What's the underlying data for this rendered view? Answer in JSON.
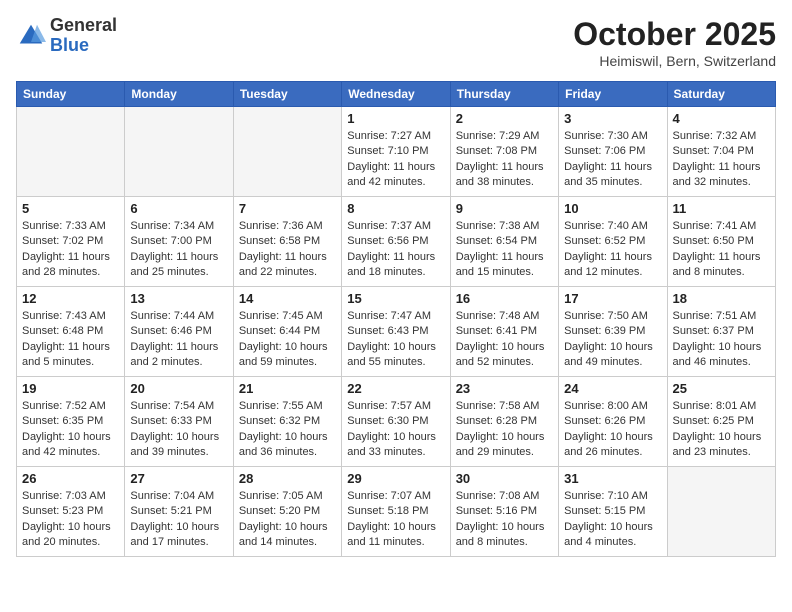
{
  "header": {
    "logo_general": "General",
    "logo_blue": "Blue",
    "month": "October 2025",
    "location": "Heimiswil, Bern, Switzerland"
  },
  "days_of_week": [
    "Sunday",
    "Monday",
    "Tuesday",
    "Wednesday",
    "Thursday",
    "Friday",
    "Saturday"
  ],
  "weeks": [
    [
      {
        "day": "",
        "info": ""
      },
      {
        "day": "",
        "info": ""
      },
      {
        "day": "",
        "info": ""
      },
      {
        "day": "1",
        "info": "Sunrise: 7:27 AM\nSunset: 7:10 PM\nDaylight: 11 hours\nand 42 minutes."
      },
      {
        "day": "2",
        "info": "Sunrise: 7:29 AM\nSunset: 7:08 PM\nDaylight: 11 hours\nand 38 minutes."
      },
      {
        "day": "3",
        "info": "Sunrise: 7:30 AM\nSunset: 7:06 PM\nDaylight: 11 hours\nand 35 minutes."
      },
      {
        "day": "4",
        "info": "Sunrise: 7:32 AM\nSunset: 7:04 PM\nDaylight: 11 hours\nand 32 minutes."
      }
    ],
    [
      {
        "day": "5",
        "info": "Sunrise: 7:33 AM\nSunset: 7:02 PM\nDaylight: 11 hours\nand 28 minutes."
      },
      {
        "day": "6",
        "info": "Sunrise: 7:34 AM\nSunset: 7:00 PM\nDaylight: 11 hours\nand 25 minutes."
      },
      {
        "day": "7",
        "info": "Sunrise: 7:36 AM\nSunset: 6:58 PM\nDaylight: 11 hours\nand 22 minutes."
      },
      {
        "day": "8",
        "info": "Sunrise: 7:37 AM\nSunset: 6:56 PM\nDaylight: 11 hours\nand 18 minutes."
      },
      {
        "day": "9",
        "info": "Sunrise: 7:38 AM\nSunset: 6:54 PM\nDaylight: 11 hours\nand 15 minutes."
      },
      {
        "day": "10",
        "info": "Sunrise: 7:40 AM\nSunset: 6:52 PM\nDaylight: 11 hours\nand 12 minutes."
      },
      {
        "day": "11",
        "info": "Sunrise: 7:41 AM\nSunset: 6:50 PM\nDaylight: 11 hours\nand 8 minutes."
      }
    ],
    [
      {
        "day": "12",
        "info": "Sunrise: 7:43 AM\nSunset: 6:48 PM\nDaylight: 11 hours\nand 5 minutes."
      },
      {
        "day": "13",
        "info": "Sunrise: 7:44 AM\nSunset: 6:46 PM\nDaylight: 11 hours\nand 2 minutes."
      },
      {
        "day": "14",
        "info": "Sunrise: 7:45 AM\nSunset: 6:44 PM\nDaylight: 10 hours\nand 59 minutes."
      },
      {
        "day": "15",
        "info": "Sunrise: 7:47 AM\nSunset: 6:43 PM\nDaylight: 10 hours\nand 55 minutes."
      },
      {
        "day": "16",
        "info": "Sunrise: 7:48 AM\nSunset: 6:41 PM\nDaylight: 10 hours\nand 52 minutes."
      },
      {
        "day": "17",
        "info": "Sunrise: 7:50 AM\nSunset: 6:39 PM\nDaylight: 10 hours\nand 49 minutes."
      },
      {
        "day": "18",
        "info": "Sunrise: 7:51 AM\nSunset: 6:37 PM\nDaylight: 10 hours\nand 46 minutes."
      }
    ],
    [
      {
        "day": "19",
        "info": "Sunrise: 7:52 AM\nSunset: 6:35 PM\nDaylight: 10 hours\nand 42 minutes."
      },
      {
        "day": "20",
        "info": "Sunrise: 7:54 AM\nSunset: 6:33 PM\nDaylight: 10 hours\nand 39 minutes."
      },
      {
        "day": "21",
        "info": "Sunrise: 7:55 AM\nSunset: 6:32 PM\nDaylight: 10 hours\nand 36 minutes."
      },
      {
        "day": "22",
        "info": "Sunrise: 7:57 AM\nSunset: 6:30 PM\nDaylight: 10 hours\nand 33 minutes."
      },
      {
        "day": "23",
        "info": "Sunrise: 7:58 AM\nSunset: 6:28 PM\nDaylight: 10 hours\nand 29 minutes."
      },
      {
        "day": "24",
        "info": "Sunrise: 8:00 AM\nSunset: 6:26 PM\nDaylight: 10 hours\nand 26 minutes."
      },
      {
        "day": "25",
        "info": "Sunrise: 8:01 AM\nSunset: 6:25 PM\nDaylight: 10 hours\nand 23 minutes."
      }
    ],
    [
      {
        "day": "26",
        "info": "Sunrise: 7:03 AM\nSunset: 5:23 PM\nDaylight: 10 hours\nand 20 minutes."
      },
      {
        "day": "27",
        "info": "Sunrise: 7:04 AM\nSunset: 5:21 PM\nDaylight: 10 hours\nand 17 minutes."
      },
      {
        "day": "28",
        "info": "Sunrise: 7:05 AM\nSunset: 5:20 PM\nDaylight: 10 hours\nand 14 minutes."
      },
      {
        "day": "29",
        "info": "Sunrise: 7:07 AM\nSunset: 5:18 PM\nDaylight: 10 hours\nand 11 minutes."
      },
      {
        "day": "30",
        "info": "Sunrise: 7:08 AM\nSunset: 5:16 PM\nDaylight: 10 hours\nand 8 minutes."
      },
      {
        "day": "31",
        "info": "Sunrise: 7:10 AM\nSunset: 5:15 PM\nDaylight: 10 hours\nand 4 minutes."
      },
      {
        "day": "",
        "info": ""
      }
    ]
  ]
}
